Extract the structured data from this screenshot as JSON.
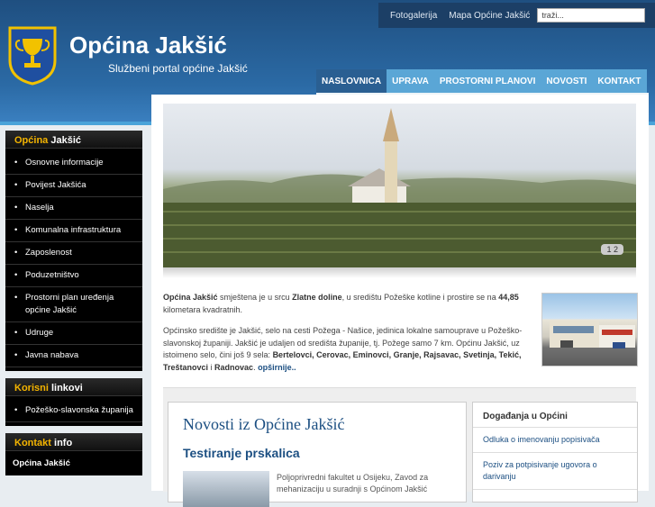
{
  "topbar": {
    "links": [
      "Fotogalerija",
      "Mapa Općine Jakšić"
    ],
    "search_value": "traži..."
  },
  "site": {
    "title": "Općina Jakšić",
    "subtitle": "Službeni portal općine Jakšić"
  },
  "mainnav": [
    "NASLOVNICA",
    "UPRAVA",
    "PROSTORNI PLANOVI",
    "NOVOSTI",
    "KONTAKT"
  ],
  "sidebar": {
    "opcina": {
      "accent": "Općina",
      "rest": " Jakšić",
      "items": [
        "Osnovne informacije",
        "Povijest Jakšića",
        "Naselja",
        "Komunalna infrastruktura",
        "Zaposlenost",
        "Poduzetništvo",
        "Prostorni plan uređenja općine Jakšić",
        "Udruge",
        "Javna nabava"
      ]
    },
    "linkovi": {
      "accent": "Korisni",
      "rest": " linkovi",
      "items": [
        "Požeško-slavonska županija"
      ]
    },
    "kontakt": {
      "accent": "Kontakt",
      "rest": " info",
      "line": "Općina Jakšić"
    }
  },
  "slider": {
    "pages": "1 2"
  },
  "intro": {
    "p1_a": "Općina Jakšić",
    "p1_b": " smještena je u srcu ",
    "p1_c": "Zlatne doline",
    "p1_d": ", u središtu Požeške kotline i prostire se na ",
    "p1_e": "44,85",
    "p1_f": " kilometara kvadratnih.",
    "p2_a": "Općinsko središte je Jakšić, selo na cesti Požega - Našice, jedinica lokalne samouprave u Požeško-slavonskoj županiji. Jakšić je udaljen od središta županije, tj. Požege samo 7 km. Općinu Jakšić, uz istoimeno selo, čini još 9 sela: ",
    "p2_b": "Bertelovci, Cerovac, Eminovci, Granje, Rajsavac, Svetinja, Tekić, Treštanovci",
    "p2_c": " i ",
    "p2_d": "Radnovac",
    "p2_e": ". ",
    "more": "opširnije.."
  },
  "news": {
    "title": "Novosti iz Općine Jakšić",
    "headline": "Testiranje prskalica",
    "text": "Poljoprivredni fakultet u Osijeku, Zavod za mehanizaciju u suradnji s Općinom Jakšić"
  },
  "events": {
    "title": "Događanja u Općini",
    "items": [
      "Odluka o imenovanju popisivača",
      "Poziv za potpisivanje ugovora o darivanju"
    ]
  },
  "colors": {
    "header": "#2b6aa5",
    "nav": "#5aa6d6",
    "accent": "#f4b400",
    "link": "#1c4f82"
  }
}
